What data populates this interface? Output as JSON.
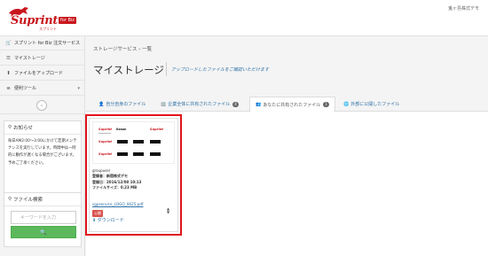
{
  "header": {
    "logo_word": "Suprint",
    "logo_biz": "for Biz",
    "logo_kana": "スプリント",
    "company": "鬼ヶ島株式デモ"
  },
  "sidebar": {
    "items": [
      {
        "icon": "cart-icon",
        "glyph": "🛒",
        "label": "スプリント for Biz 注文サービス"
      },
      {
        "icon": "list-icon",
        "glyph": "☰",
        "label": "マイストレージ"
      },
      {
        "icon": "upload-icon",
        "glyph": "⬆",
        "label": "ファイルをアップロード"
      },
      {
        "icon": "menu-icon",
        "glyph": "≡",
        "label": "便利ツール",
        "caret": "▾"
      }
    ],
    "toggle_glyph": "‹",
    "notice": {
      "title": "お知らせ",
      "body": "毎日AM2:00～3:00にかけて定期メンテナンスを実行しています。時間中は一時的に動作が遅くなる場合がございます。予めご了承ください。"
    },
    "file_search": {
      "title": "ファイル検索",
      "placeholder": "キーワードを入力",
      "button_glyph": "🔍"
    }
  },
  "main": {
    "breadcrumb": "ストレージサービス › 一覧",
    "title": "マイストレージ",
    "title_desc": "アップロードしたファイルをご確認いただけます",
    "tabs": [
      {
        "glyph": "👤",
        "label": "自分自身のファイル",
        "badge": ""
      },
      {
        "glyph": "🏢",
        "label": "企業全体に共有されたファイル",
        "badge": "4"
      },
      {
        "glyph": "👥",
        "label": "あなたに共有されたファイル",
        "badge": "1",
        "active": true
      },
      {
        "glyph": "🌐",
        "label": "外部に公開したファイル",
        "badge": ""
      }
    ]
  },
  "file_card": {
    "thumb_logos": [
      "Suprint",
      "Kanon",
      "Suprint",
      "Suprint",
      "Suprint"
    ],
    "owner": "groupuser",
    "owner_label": "登録者：新宿株式デモ",
    "date_label": "登録日：2016/12/08 10:13",
    "size_label": "ファイルサイズ：0.23 MB",
    "filename": "sgpservice_LOGO_0625.pdf",
    "tag": "公開",
    "download": "ダウンロード"
  },
  "colors": {
    "brand_red": "#c8161d",
    "link_blue": "#2c6fa6",
    "highlight_red": "#e0141b",
    "search_green": "#5cb85c"
  }
}
